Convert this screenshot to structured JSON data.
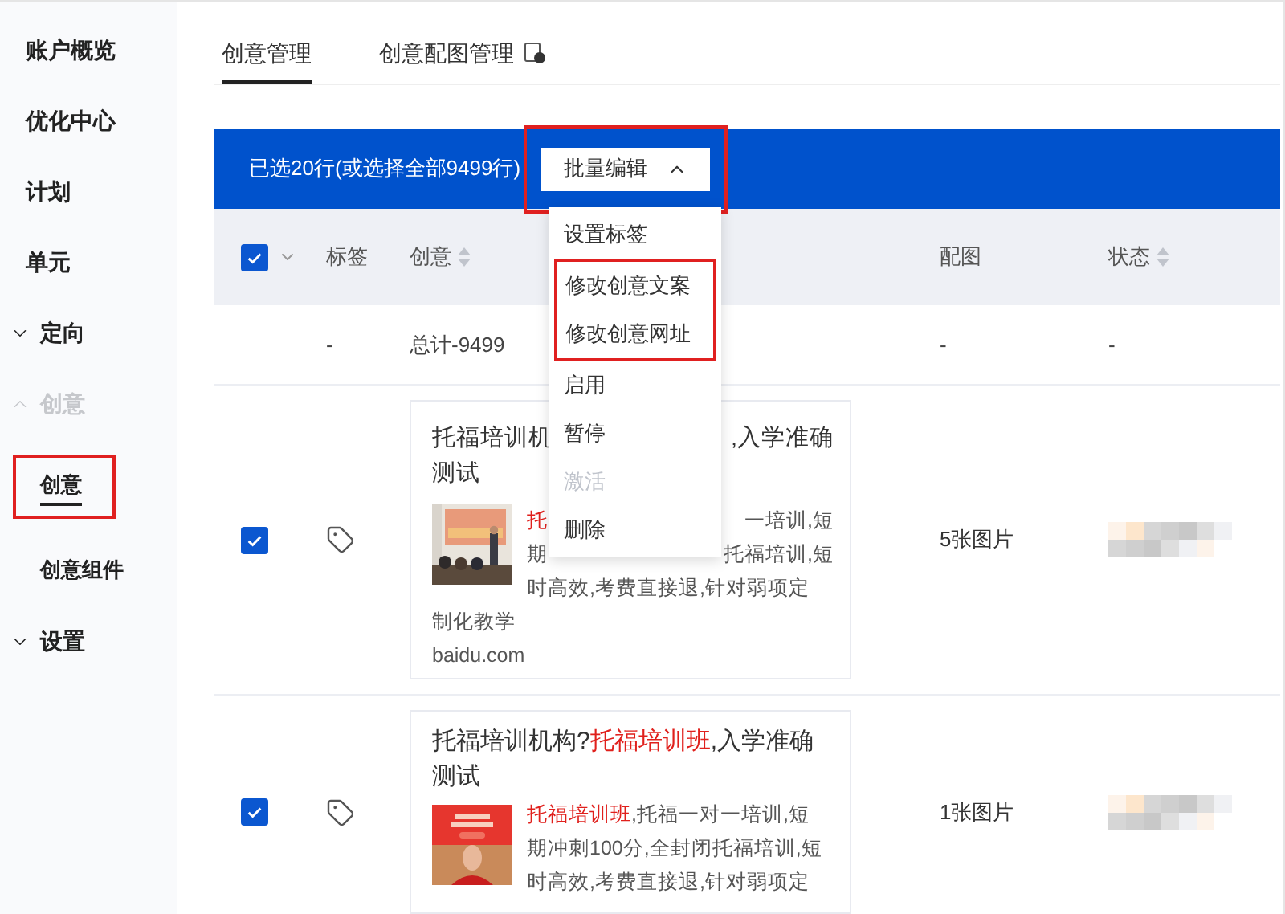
{
  "sidebar": {
    "items": [
      {
        "kind": "link",
        "label": "账户概览",
        "selected": false
      },
      {
        "kind": "link",
        "label": "优化中心",
        "selected": false
      },
      {
        "kind": "link",
        "label": "计划",
        "selected": false
      },
      {
        "kind": "link",
        "label": "单元",
        "selected": false
      },
      {
        "kind": "group",
        "label": "定向",
        "expanded": false
      },
      {
        "kind": "group",
        "label": "创意",
        "expanded": true,
        "children": [
          {
            "label": "创意",
            "selected": true,
            "annotated": true
          },
          {
            "label": "创意组件",
            "selected": false,
            "annotated": false
          }
        ]
      },
      {
        "kind": "group",
        "label": "设置",
        "expanded": false
      }
    ]
  },
  "tabs": [
    {
      "label": "创意管理",
      "selected": true,
      "help": false
    },
    {
      "label": "创意配图管理",
      "selected": false,
      "help": true
    }
  ],
  "selection_bar": {
    "text": "已选20行(或选择全部9499行)",
    "button": {
      "label": "批量编辑",
      "expanded": true,
      "annotated": true
    }
  },
  "menu": {
    "items": [
      {
        "label": "设置标签",
        "disabled": false,
        "annotated": false
      },
      {
        "label": "修改创意文案",
        "disabled": false,
        "annotated": true
      },
      {
        "label": "修改创意网址",
        "disabled": false,
        "annotated": true
      },
      {
        "label": "启用",
        "disabled": false,
        "annotated": false
      },
      {
        "label": "暂停",
        "disabled": false,
        "annotated": false
      },
      {
        "label": "激活",
        "disabled": true,
        "annotated": false
      },
      {
        "label": "删除",
        "disabled": false,
        "annotated": false
      }
    ]
  },
  "table": {
    "header": {
      "checked": true,
      "columns": [
        {
          "label": "标签",
          "sortable": false
        },
        {
          "label": "创意",
          "sortable": true
        },
        {
          "label": "配图",
          "sortable": false
        },
        {
          "label": "状态",
          "sortable": true
        }
      ]
    },
    "total_row": [
      "-",
      "总计-9499",
      "-",
      "-"
    ],
    "rows": [
      {
        "checked": true,
        "card": {
          "kind": "split",
          "title_lines": [
            {
              "left": "托福培训机",
              "right": ",入学准确"
            },
            {
              "left": "测试"
            }
          ],
          "body_lines": [
            {
              "left": "托",
              "left_red": true,
              "right": "一培训,短"
            },
            {
              "left": "期",
              "left_red": false,
              "right": "托福培训,短"
            },
            {
              "left": "时高效,考费直接退,针对弱项定",
              "left_red": false
            }
          ],
          "tail": "制化教学",
          "url": "baidu.com"
        },
        "images": "5张图片"
      },
      {
        "checked": true,
        "card": {
          "kind": "full",
          "title": [
            {
              "text": "托福培训机构?",
              "red": false
            },
            {
              "text": "托福培训班",
              "red": true
            },
            {
              "text": ",入学准确测试",
              "red": false
            }
          ],
          "body": [
            {
              "text": "托福培训班",
              "red": true
            },
            {
              "text": ",托福一对一培训,短期冲刺100分,全封闭托福培训,短时高效,考费直接退,针对弱项定",
              "red": false
            }
          ]
        },
        "images": "1张图片"
      }
    ]
  }
}
